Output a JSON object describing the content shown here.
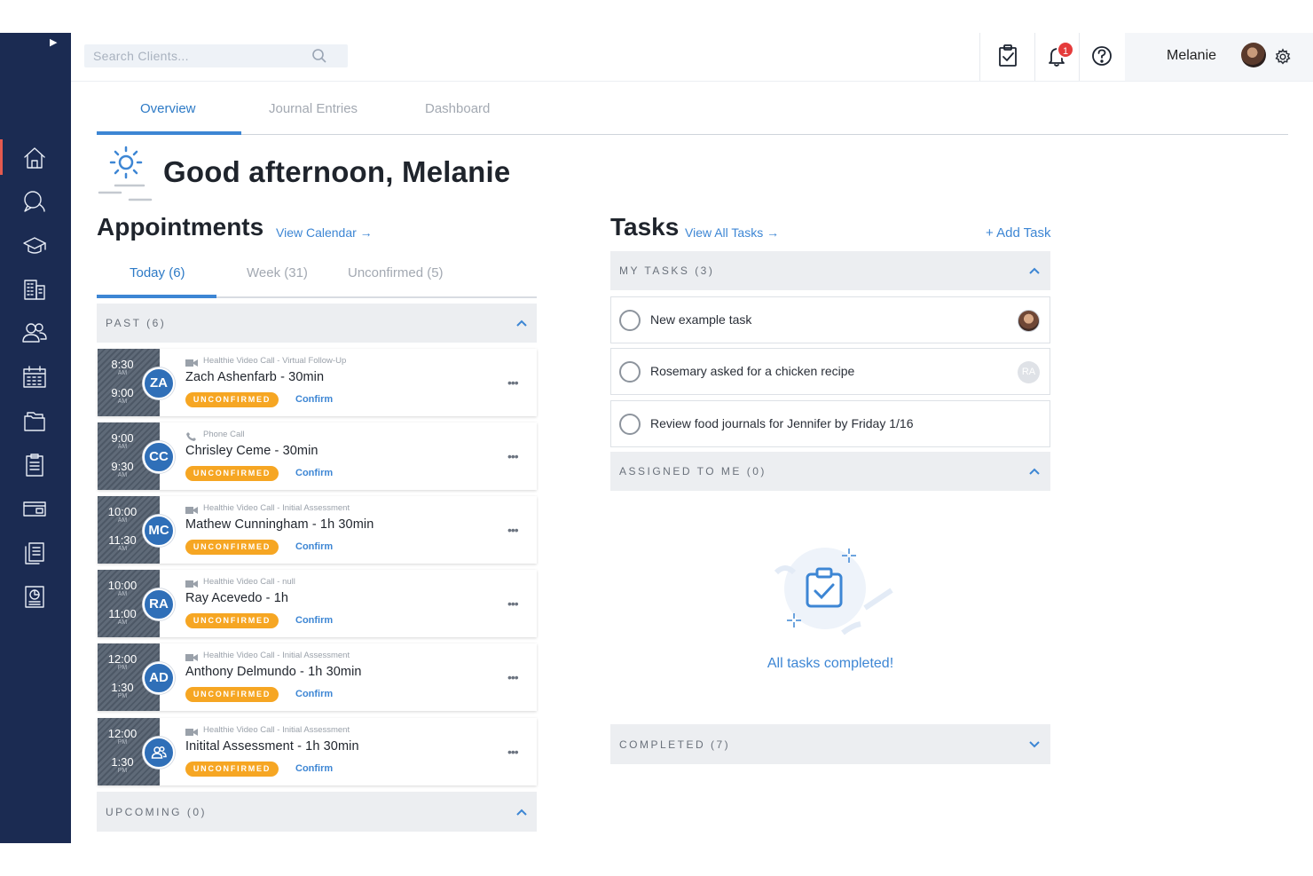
{
  "colors": {
    "sidebar": "#1b2b52",
    "accent": "#3d86d4",
    "unconfirmed_badge": "#f6a623",
    "notification_badge": "#e53b3b"
  },
  "sidebar": {
    "items": [
      {
        "icon": "home-icon"
      },
      {
        "icon": "chat-icon"
      },
      {
        "icon": "graduation-cap-icon"
      },
      {
        "icon": "building-icon"
      },
      {
        "icon": "users-icon"
      },
      {
        "icon": "calendar-icon"
      },
      {
        "icon": "folders-icon"
      },
      {
        "icon": "clipboard-icon"
      },
      {
        "icon": "billing-icon"
      },
      {
        "icon": "documents-icon"
      },
      {
        "icon": "reports-icon"
      }
    ]
  },
  "header": {
    "search_placeholder": "Search Clients...",
    "notification_count": "1",
    "user_name": "Melanie"
  },
  "tabs": [
    {
      "label": "Overview",
      "active": true
    },
    {
      "label": "Journal Entries",
      "active": false
    },
    {
      "label": "Dashboard",
      "active": false
    }
  ],
  "greeting": "Good afternoon, Melanie",
  "appointments": {
    "title": "Appointments",
    "link": "View Calendar →",
    "tabs": [
      {
        "label": "Today (6)",
        "active": true
      },
      {
        "label": "Week (31)",
        "active": false
      },
      {
        "label": "Unconfirmed (5)",
        "active": false
      }
    ],
    "past_label": "PAST (6)",
    "upcoming_label": "UPCOMING (0)",
    "items": [
      {
        "start": "8:30",
        "start_ampm": "AM",
        "end": "9:00",
        "end_ampm": "AM",
        "initials": "ZA",
        "type_icon": "video-icon",
        "type": "Healthie Video Call - Virtual Follow-Up",
        "title": "Zach Ashenfarb - 30min",
        "status": "UNCONFIRMED",
        "action": "Confirm"
      },
      {
        "start": "9:00",
        "start_ampm": "AM",
        "end": "9:30",
        "end_ampm": "AM",
        "initials": "CC",
        "type_icon": "phone-icon",
        "type": "Phone Call",
        "title": "Chrisley Ceme - 30min",
        "status": "UNCONFIRMED",
        "action": "Confirm"
      },
      {
        "start": "10:00",
        "start_ampm": "AM",
        "end": "11:30",
        "end_ampm": "AM",
        "initials": "MC",
        "type_icon": "video-icon",
        "type": "Healthie Video Call - Initial Assessment",
        "title": "Mathew Cunningham - 1h 30min",
        "status": "UNCONFIRMED",
        "action": "Confirm"
      },
      {
        "start": "10:00",
        "start_ampm": "AM",
        "end": "11:00",
        "end_ampm": "AM",
        "initials": "RA",
        "type_icon": "video-icon",
        "type": "Healthie Video Call - null",
        "title": "Ray Acevedo - 1h",
        "status": "UNCONFIRMED",
        "action": "Confirm"
      },
      {
        "start": "12:00",
        "start_ampm": "PM",
        "end": "1:30",
        "end_ampm": "PM",
        "initials": "AD",
        "type_icon": "video-icon",
        "type": "Healthie Video Call - Initial Assessment",
        "title": "Anthony Delmundo - 1h 30min",
        "status": "UNCONFIRMED",
        "action": "Confirm"
      },
      {
        "start": "12:00",
        "start_ampm": "PM",
        "end": "1:30",
        "end_ampm": "PM",
        "initials": "",
        "type_icon": "video-icon",
        "type": "Healthie Video Call - Initial Assessment",
        "title": "Initital Assessment - 1h 30min",
        "status": "UNCONFIRMED",
        "action": "Confirm"
      }
    ]
  },
  "tasks": {
    "title": "Tasks",
    "link": "View All Tasks →",
    "add_label": "+ Add Task",
    "my_tasks_label": "MY TASKS (3)",
    "assigned_label": "ASSIGNED TO ME (0)",
    "completed_label": "COMPLETED (7)",
    "items": [
      {
        "text": "New example task",
        "assignee": "photo"
      },
      {
        "text": "Rosemary asked for a chicken recipe",
        "assignee": "RA"
      },
      {
        "text": "Review food journals for Jennifer by Friday 1/16",
        "assignee": ""
      }
    ],
    "empty_message": "All tasks completed!"
  }
}
